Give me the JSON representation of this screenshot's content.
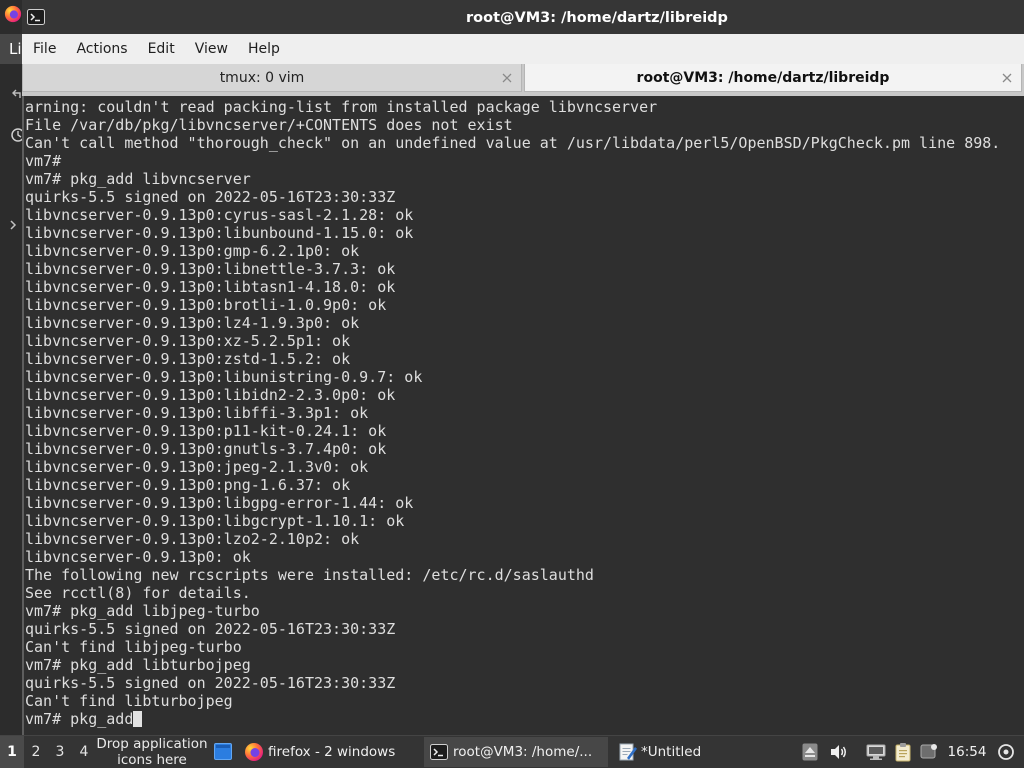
{
  "window": {
    "title": "root@VM3: /home/dartz/libreidp",
    "icon": "terminal-icon"
  },
  "menu": {
    "items": [
      "File",
      "Actions",
      "Edit",
      "View",
      "Help"
    ]
  },
  "tabs": [
    {
      "label": "tmux: 0 vim",
      "active": false,
      "close_icon": "close-icon"
    },
    {
      "label": "root@VM3: /home/dartz/libreidp",
      "active": true,
      "close_icon": "close-icon"
    }
  ],
  "terminal": {
    "lines": [
      "arning: couldn't read packing-list from installed package libvncserver",
      "File /var/db/pkg/libvncserver/+CONTENTS does not exist",
      "Can't call method \"thorough_check\" on an undefined value at /usr/libdata/perl5/OpenBSD/PkgCheck.pm line 898.",
      "vm7#",
      "vm7# pkg_add libvncserver",
      "quirks-5.5 signed on 2022-05-16T23:30:33Z",
      "libvncserver-0.9.13p0:cyrus-sasl-2.1.28: ok",
      "libvncserver-0.9.13p0:libunbound-1.15.0: ok",
      "libvncserver-0.9.13p0:gmp-6.2.1p0: ok",
      "libvncserver-0.9.13p0:libnettle-3.7.3: ok",
      "libvncserver-0.9.13p0:libtasn1-4.18.0: ok",
      "libvncserver-0.9.13p0:brotli-1.0.9p0: ok",
      "libvncserver-0.9.13p0:lz4-1.9.3p0: ok",
      "libvncserver-0.9.13p0:xz-5.2.5p1: ok",
      "libvncserver-0.9.13p0:zstd-1.5.2: ok",
      "libvncserver-0.9.13p0:libunistring-0.9.7: ok",
      "libvncserver-0.9.13p0:libidn2-2.3.0p0: ok",
      "libvncserver-0.9.13p0:libffi-3.3p1: ok",
      "libvncserver-0.9.13p0:p11-kit-0.24.1: ok",
      "libvncserver-0.9.13p0:gnutls-3.7.4p0: ok",
      "libvncserver-0.9.13p0:jpeg-2.1.3v0: ok",
      "libvncserver-0.9.13p0:png-1.6.37: ok",
      "libvncserver-0.9.13p0:libgpg-error-1.44: ok",
      "libvncserver-0.9.13p0:libgcrypt-1.10.1: ok",
      "libvncserver-0.9.13p0:lzo2-2.10p2: ok",
      "libvncserver-0.9.13p0: ok",
      "The following new rcscripts were installed: /etc/rc.d/saslauthd",
      "See rcctl(8) for details.",
      "vm7# pkg_add libjpeg-turbo",
      "quirks-5.5 signed on 2022-05-16T23:30:33Z",
      "Can't find libjpeg-turbo",
      "vm7# pkg_add libturbojpeg",
      "quirks-5.5 signed on 2022-05-16T23:30:33Z",
      "Can't find libturbojpeg",
      "vm7# pkg_add"
    ],
    "cursor_visible": true
  },
  "background_window": {
    "tab_label": "Li",
    "icons": [
      "firefox-icon",
      "back-icon",
      "history-icon",
      "chevron-right-icon"
    ]
  },
  "taskbar": {
    "workspaces": [
      {
        "label": "1",
        "active": true
      },
      {
        "label": "2",
        "active": false
      },
      {
        "label": "3",
        "active": false
      },
      {
        "label": "4",
        "active": false
      }
    ],
    "quicklaunch_placeholder": "Drop application icons here",
    "show_desktop_icon": "show-desktop-icon",
    "tasks": [
      {
        "label": "firefox - 2 windows",
        "icon": "firefox-icon",
        "active": false
      },
      {
        "label": "root@VM3: /home/...",
        "icon": "terminal-icon",
        "active": true
      },
      {
        "label": "*Untitled",
        "icon": "text-editor-icon",
        "active": false
      }
    ],
    "tray": {
      "icons": [
        "removable-media-icon",
        "volume-icon",
        "network-icon",
        "clipboard-icon",
        "notification-icon"
      ],
      "clock": "16:54",
      "end_icon": "power-icon"
    }
  },
  "colors": {
    "desktop_bg": "#2b2b2b",
    "titlebar_bg": "#363636",
    "titlebar_fg": "#ffffff",
    "menubar_bg": "#efefef",
    "menubar_fg": "#1f1f1f",
    "tabbar_bg": "#c8c8c8",
    "tab_inactive_bg": "#d6d6d6",
    "tab_active_bg": "#f3f3f3",
    "terminal_bg": "#2f2f2f",
    "terminal_fg": "#dedede",
    "taskbar_bg": "#343434",
    "taskbar_fg": "#f0f0f0"
  }
}
